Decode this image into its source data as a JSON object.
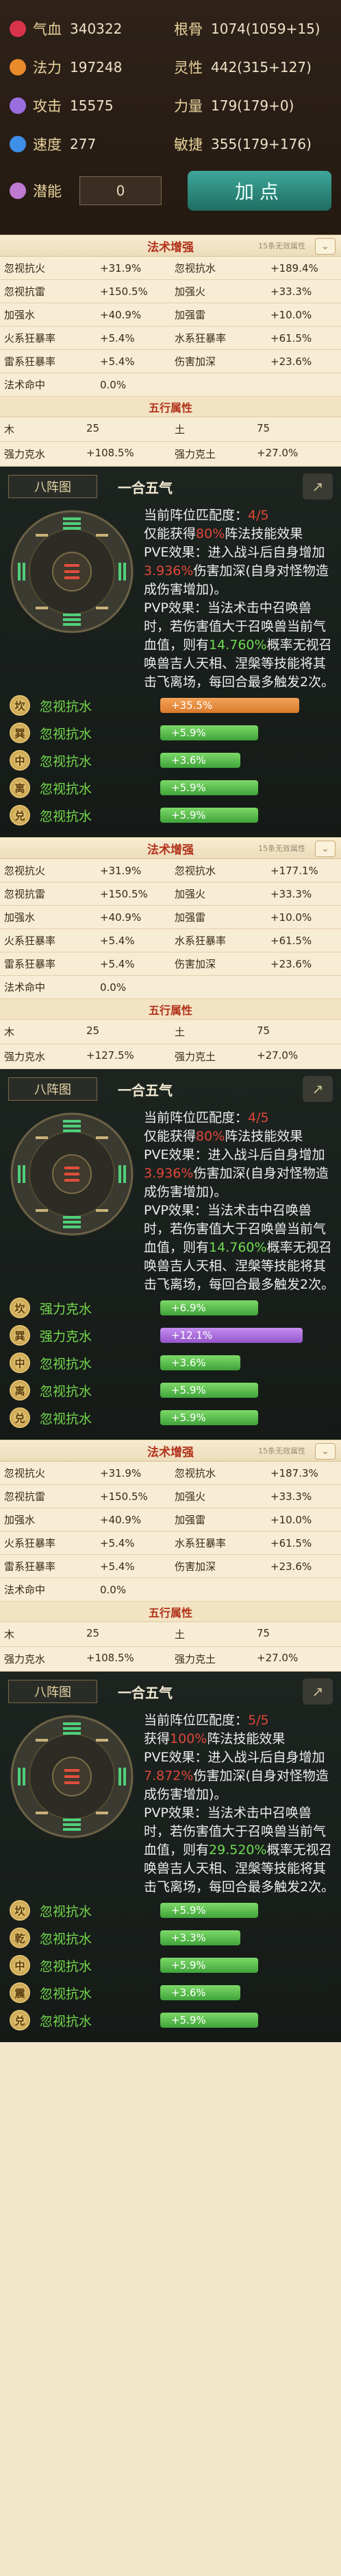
{
  "stats": {
    "rows": [
      [
        {
          "name": "气血",
          "value": "340322",
          "icon": "heart-icon",
          "color": "#d8334b"
        },
        {
          "name": "根骨",
          "value": "1074(1059+15)"
        }
      ],
      [
        {
          "name": "法力",
          "value": "197248",
          "icon": "mana-swirl-icon",
          "color": "#e98a2b"
        },
        {
          "name": "灵性",
          "value": "442(315+127)"
        }
      ],
      [
        {
          "name": "攻击",
          "value": "15575",
          "icon": "sword-icon",
          "color": "#9b6ee0"
        },
        {
          "name": "力量",
          "value": "179(179+0)"
        }
      ],
      [
        {
          "name": "速度",
          "value": "277",
          "icon": "boot-icon",
          "color": "#3e8fe8"
        },
        {
          "name": "敏捷",
          "value": "355(179+176)"
        }
      ]
    ],
    "potential": {
      "name": "潜能",
      "value": "0",
      "icon": "potential-icon",
      "color": "#c07ad2"
    },
    "add_button": "加点"
  },
  "sections": [
    {
      "title": "法术增强",
      "subtitle": "15条无效属性",
      "rows": [
        [
          [
            "忽视抗火",
            "+31.9%"
          ],
          [
            "忽视抗水",
            "+189.4%"
          ]
        ],
        [
          [
            "忽视抗雷",
            "+150.5%"
          ],
          [
            "加强火",
            "+33.3%"
          ]
        ],
        [
          [
            "加强水",
            "+40.9%"
          ],
          [
            "加强雷",
            "+10.0%"
          ]
        ],
        [
          [
            "火系狂暴率",
            "+5.4%"
          ],
          [
            "水系狂暴率",
            "+61.5%"
          ]
        ],
        [
          [
            "雷系狂暴率",
            "+5.4%"
          ],
          [
            "伤害加深",
            "+23.6%"
          ]
        ],
        [
          [
            "法术命中",
            "0.0%"
          ],
          [
            "",
            ""
          ]
        ]
      ],
      "five_title": "五行属性",
      "five": [
        [
          [
            "木",
            "25"
          ],
          [
            "土",
            "75"
          ]
        ],
        [
          [
            "强力克水",
            "+108.5%"
          ],
          [
            "强力克土",
            "+27.0%"
          ]
        ]
      ],
      "formation": {
        "tab": "八阵图",
        "name": "一合五气",
        "desc_a": "当前阵位匹配度：",
        "match": "4/5",
        "desc_b": "仅能获得",
        "percent": "80%",
        "desc_c": "阵法技能效果",
        "pve_a": "PVE效果：进入战斗后自身增加",
        "pve_val": "3.936%",
        "pve_b": "伤害加深(自身对怪物造成伤害增加)。",
        "pvp_a": "PVP效果：当法术击中召唤兽时，若伤害值大于召唤兽当前气血值，则有",
        "pvp_val": "14.760%",
        "pvp_b": "概率无视召唤兽吉人天相、涅槃等技能将其击飞离场，每回合最多触发2次。",
        "positions": [
          {
            "badge": "坎",
            "label": "忽视抗水",
            "bar": "+35.5%",
            "color": "org",
            "fill": 0.78
          },
          {
            "badge": "巽",
            "label": "忽视抗水",
            "bar": "+5.9%",
            "color": "grn2",
            "fill": 0.55
          },
          {
            "badge": "中",
            "label": "忽视抗水",
            "bar": "+3.6%",
            "color": "grn2",
            "fill": 0.45
          },
          {
            "badge": "离",
            "label": "忽视抗水",
            "bar": "+5.9%",
            "color": "grn2",
            "fill": 0.55
          },
          {
            "badge": "兑",
            "label": "忽视抗水",
            "bar": "+5.9%",
            "color": "grn2",
            "fill": 0.55
          }
        ]
      }
    },
    {
      "title": "法术增强",
      "subtitle": "15条无效属性",
      "rows": [
        [
          [
            "忽视抗火",
            "+31.9%"
          ],
          [
            "忽视抗水",
            "+177.1%"
          ]
        ],
        [
          [
            "忽视抗雷",
            "+150.5%"
          ],
          [
            "加强火",
            "+33.3%"
          ]
        ],
        [
          [
            "加强水",
            "+40.9%"
          ],
          [
            "加强雷",
            "+10.0%"
          ]
        ],
        [
          [
            "火系狂暴率",
            "+5.4%"
          ],
          [
            "水系狂暴率",
            "+61.5%"
          ]
        ],
        [
          [
            "雷系狂暴率",
            "+5.4%"
          ],
          [
            "伤害加深",
            "+23.6%"
          ]
        ],
        [
          [
            "法术命中",
            "0.0%"
          ],
          [
            "",
            ""
          ]
        ]
      ],
      "five_title": "五行属性",
      "five": [
        [
          [
            "木",
            "25"
          ],
          [
            "土",
            "75"
          ]
        ],
        [
          [
            "强力克水",
            "+127.5%"
          ],
          [
            "强力克土",
            "+27.0%"
          ]
        ]
      ],
      "formation": {
        "tab": "八阵图",
        "name": "一合五气",
        "desc_a": "当前阵位匹配度：",
        "match": "4/5",
        "desc_b": "仅能获得",
        "percent": "80%",
        "desc_c": "阵法技能效果",
        "pve_a": "PVE效果：进入战斗后自身增加",
        "pve_val": "3.936%",
        "pve_b": "伤害加深(自身对怪物造成伤害增加)。",
        "pvp_a": "PVP效果：当法术击中召唤兽时，若伤害值大于召唤兽当前气血值，则有",
        "pvp_val": "14.760%",
        "pvp_b": "概率无视召唤兽吉人天相、涅槃等技能将其击飞离场，每回合最多触发2次。",
        "positions": [
          {
            "badge": "坎",
            "label": "强力克水",
            "bar": "+6.9%",
            "color": "grn2",
            "fill": 0.55
          },
          {
            "badge": "巽",
            "label": "强力克水",
            "bar": "+12.1%",
            "color": "pur",
            "fill": 0.8
          },
          {
            "badge": "中",
            "label": "忽视抗水",
            "bar": "+3.6%",
            "color": "grn2",
            "fill": 0.45
          },
          {
            "badge": "离",
            "label": "忽视抗水",
            "bar": "+5.9%",
            "color": "grn2",
            "fill": 0.55
          },
          {
            "badge": "兑",
            "label": "忽视抗水",
            "bar": "+5.9%",
            "color": "grn2",
            "fill": 0.55
          }
        ]
      }
    },
    {
      "title": "法术增强",
      "subtitle": "15条无效属性",
      "rows": [
        [
          [
            "忽视抗火",
            "+31.9%"
          ],
          [
            "忽视抗水",
            "+187.3%"
          ]
        ],
        [
          [
            "忽视抗雷",
            "+150.5%"
          ],
          [
            "加强火",
            "+33.3%"
          ]
        ],
        [
          [
            "加强水",
            "+40.9%"
          ],
          [
            "加强雷",
            "+10.0%"
          ]
        ],
        [
          [
            "火系狂暴率",
            "+5.4%"
          ],
          [
            "水系狂暴率",
            "+61.5%"
          ]
        ],
        [
          [
            "雷系狂暴率",
            "+5.4%"
          ],
          [
            "伤害加深",
            "+23.6%"
          ]
        ],
        [
          [
            "法术命中",
            "0.0%"
          ],
          [
            "",
            ""
          ]
        ]
      ],
      "five_title": "五行属性",
      "five": [
        [
          [
            "木",
            "25"
          ],
          [
            "土",
            "75"
          ]
        ],
        [
          [
            "强力克水",
            "+108.5%"
          ],
          [
            "强力克土",
            "+27.0%"
          ]
        ]
      ],
      "formation": {
        "tab": "八阵图",
        "name": "一合五气",
        "desc_a": "当前阵位匹配度：",
        "match": "5/5",
        "desc_b": "获得",
        "percent": "100%",
        "desc_c": "阵法技能效果",
        "pve_a": "PVE效果：进入战斗后自身增加",
        "pve_val": "7.872%",
        "pve_b": "伤害加深(自身对怪物造成伤害增加)。",
        "pvp_a": "PVP效果：当法术击中召唤兽时，若伤害值大于召唤兽当前气血值，则有",
        "pvp_val": "29.520%",
        "pvp_b": "概率无视召唤兽吉人天相、涅槃等技能将其击飞离场，每回合最多触发2次。",
        "positions": [
          {
            "badge": "坎",
            "label": "忽视抗水",
            "bar": "+5.9%",
            "color": "grn2",
            "fill": 0.55
          },
          {
            "badge": "乾",
            "label": "忽视抗水",
            "bar": "+3.3%",
            "color": "grn2",
            "fill": 0.45
          },
          {
            "badge": "中",
            "label": "忽视抗水",
            "bar": "+5.9%",
            "color": "grn2",
            "fill": 0.55
          },
          {
            "badge": "震",
            "label": "忽视抗水",
            "bar": "+3.6%",
            "color": "grn2",
            "fill": 0.45
          },
          {
            "badge": "兑",
            "label": "忽视抗水",
            "bar": "+5.9%",
            "color": "grn2",
            "fill": 0.55
          }
        ]
      }
    }
  ]
}
